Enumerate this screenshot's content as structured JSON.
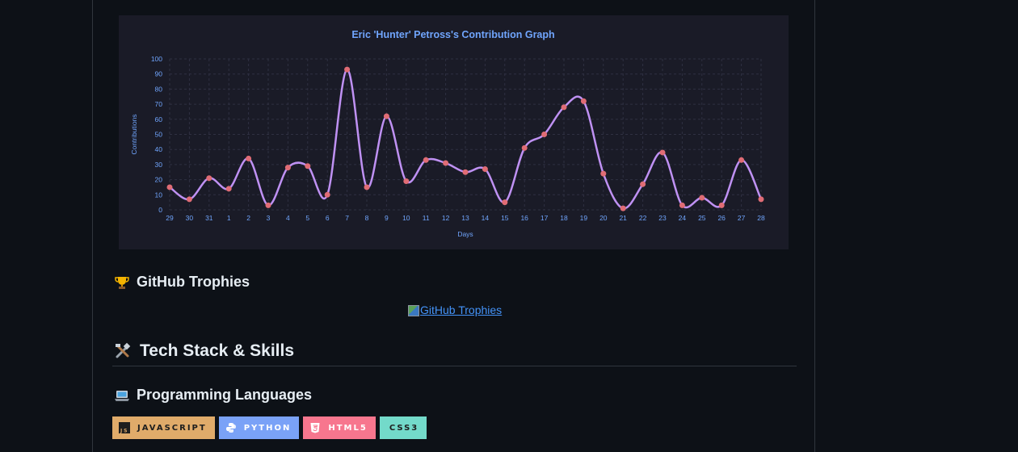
{
  "colors": {
    "page_bg": "#0d1117",
    "card_bg": "#1a1b27",
    "title": "#70a5fd",
    "line": "#bf91f3",
    "points": "#e06c75",
    "link": "#4493f8",
    "grid": "#2f3042"
  },
  "chart_data": {
    "type": "line",
    "title": "Eric 'Hunter' Petross's Contribution Graph",
    "xlabel": "Days",
    "ylabel": "Contributions",
    "ylim": [
      0,
      100
    ],
    "yticks": [
      0,
      10,
      20,
      30,
      40,
      50,
      60,
      70,
      80,
      90,
      100
    ],
    "grid": true,
    "x": [
      "29",
      "30",
      "31",
      "1",
      "2",
      "3",
      "4",
      "5",
      "6",
      "7",
      "8",
      "9",
      "10",
      "11",
      "12",
      "13",
      "14",
      "15",
      "16",
      "17",
      "18",
      "19",
      "20",
      "21",
      "22",
      "23",
      "24",
      "25",
      "26",
      "27",
      "28"
    ],
    "series": [
      {
        "values": [
          15,
          7,
          21,
          14,
          34,
          3,
          28,
          29,
          10,
          93,
          15,
          62,
          19,
          33,
          31,
          25,
          27,
          5,
          41,
          50,
          68,
          72,
          24,
          1,
          17,
          38,
          3,
          8,
          3,
          33,
          7
        ]
      }
    ]
  },
  "trophies": {
    "heading": "GitHub Trophies",
    "emoji": "trophy-icon",
    "link_text": "GitHub Trophies"
  },
  "tech": {
    "heading": "Tech Stack & Skills",
    "emoji": "tools-icon"
  },
  "languages": {
    "heading": "Programming Languages",
    "emoji": "laptop-icon",
    "badges": [
      {
        "label": "JAVASCRIPT",
        "icon": "javascript-icon",
        "bg": "#e0ab6a",
        "fg": "#1e1e1e"
      },
      {
        "label": "PYTHON",
        "icon": "python-icon",
        "bg": "#7aa2f7",
        "fg": "#ffffff"
      },
      {
        "label": "HTML5",
        "icon": "html5-icon",
        "bg": "#f7768e",
        "fg": "#ffffff"
      },
      {
        "label": "CSS3",
        "icon": "",
        "bg": "#73daca",
        "fg": "#1e1e1e"
      }
    ]
  }
}
